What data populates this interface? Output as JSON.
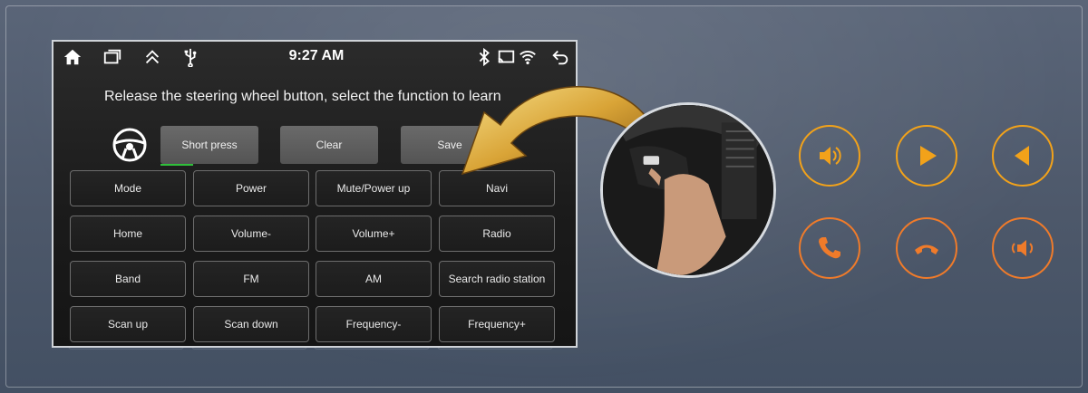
{
  "status_bar": {
    "icons": [
      "home-icon",
      "recent-apps-icon",
      "expand-up-icon",
      "usb-icon",
      "bluetooth-icon",
      "screen-mirror-icon",
      "wifi-icon",
      "back-icon"
    ],
    "time": "9:27 AM"
  },
  "screen": {
    "instruction": "Release the steering wheel button, select the function to learn",
    "top_buttons": [
      "Short press",
      "Clear",
      "Save"
    ],
    "functions": [
      [
        "Mode",
        "Power",
        "Mute/Power up",
        "Navi"
      ],
      [
        "Home",
        "Volume-",
        "Volume+",
        "Radio"
      ],
      [
        "Band",
        "FM",
        "AM",
        "Search radio station"
      ],
      [
        "Scan up",
        "Scan down",
        "Frequency-",
        "Frequency+"
      ]
    ]
  },
  "side_buttons": [
    {
      "icon": "volume-icon",
      "color": "#f2a21a"
    },
    {
      "icon": "play-icon",
      "color": "#f2a21a"
    },
    {
      "icon": "previous-icon",
      "color": "#f2a21a"
    },
    {
      "icon": "call-answer-icon",
      "color": "#f07b2a"
    },
    {
      "icon": "call-hangup-icon",
      "color": "#f07b2a"
    },
    {
      "icon": "mute-icon",
      "color": "#f07b2a"
    }
  ],
  "colors": {
    "accent_yellow": "#f2a21a",
    "accent_orange": "#f07b2a",
    "active_indicator": "#2fbf3a"
  }
}
